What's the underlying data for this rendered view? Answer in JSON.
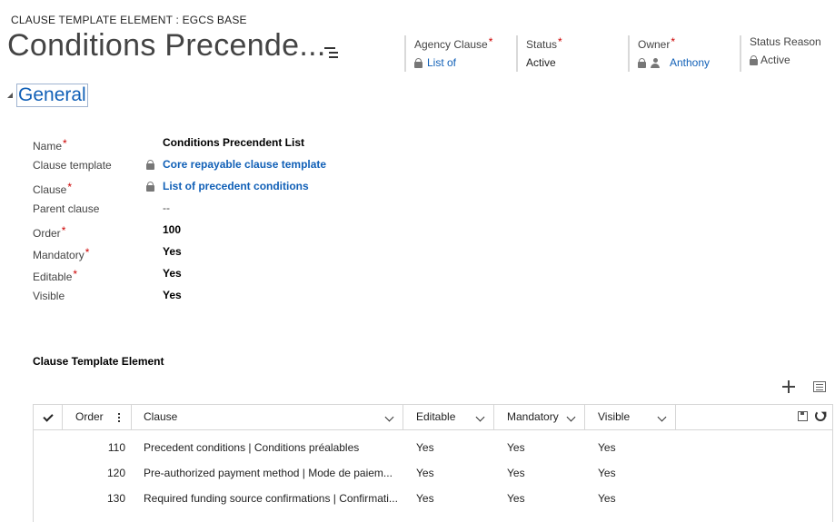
{
  "header": {
    "entity_type": "CLAUSE TEMPLATE ELEMENT : EGCS BASE",
    "record_title": "Conditions Precende...",
    "fields": [
      {
        "label": "Agency Clause",
        "required": "*",
        "value": "List of"
      },
      {
        "label": "Status",
        "required": "*",
        "value": "Active"
      },
      {
        "label": "Owner",
        "required": "*",
        "value": "Anthony"
      },
      {
        "label": "Status Reason",
        "required": "",
        "value": "Active"
      }
    ]
  },
  "section": {
    "title": "General"
  },
  "form": [
    {
      "label": "Name",
      "required": "*",
      "value": "Conditions Precendent List"
    },
    {
      "label": "Clause template",
      "required": "",
      "value": "Core repayable clause template"
    },
    {
      "label": "Clause",
      "required": "*",
      "value": "List of precedent conditions"
    },
    {
      "label": "Parent clause",
      "required": "",
      "value": "--"
    },
    {
      "label": "Order",
      "required": "*",
      "value": "100"
    },
    {
      "label": "Mandatory",
      "required": "*",
      "value": "Yes"
    },
    {
      "label": "Editable",
      "required": "*",
      "value": "Yes"
    },
    {
      "label": "Visible",
      "required": "",
      "value": "Yes"
    }
  ],
  "subgrid": {
    "title": "Clause Template Element",
    "columns": [
      "Order",
      "Clause",
      "Editable",
      "Mandatory",
      "Visible"
    ],
    "rows": [
      {
        "order": "110",
        "clause": "Precedent conditions | Conditions préalables",
        "editable": "Yes",
        "mandatory": "Yes",
        "visible": "Yes"
      },
      {
        "order": "120",
        "clause": "Pre-authorized payment method | Mode de paiem...",
        "editable": "Yes",
        "mandatory": "Yes",
        "visible": "Yes"
      },
      {
        "order": "130",
        "clause": "Required funding source confirmations | Confirmati...",
        "editable": "Yes",
        "mandatory": "Yes",
        "visible": "Yes"
      }
    ]
  },
  "colors": {
    "link": "#1160b7",
    "required": "#cc0000"
  }
}
